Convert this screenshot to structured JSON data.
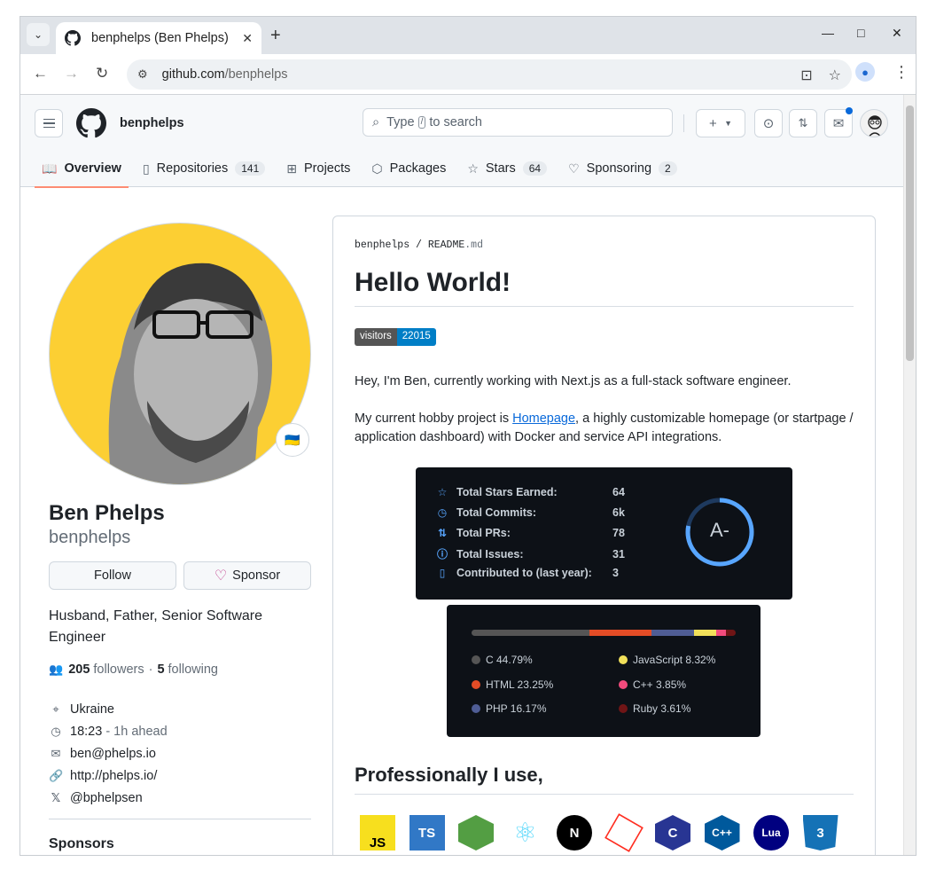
{
  "browser": {
    "tab_title": "benphelps (Ben Phelps)",
    "url_host": "github.com",
    "url_path": "/benphelps"
  },
  "header": {
    "username": "benphelps",
    "search_before": "Type",
    "search_key": "/",
    "search_after": "to search"
  },
  "nav": [
    {
      "label": "Overview",
      "count": null,
      "icon": "book-icon"
    },
    {
      "label": "Repositories",
      "count": "141",
      "icon": "repo-icon"
    },
    {
      "label": "Projects",
      "count": null,
      "icon": "table-icon"
    },
    {
      "label": "Packages",
      "count": null,
      "icon": "package-icon"
    },
    {
      "label": "Stars",
      "count": "64",
      "icon": "star-icon"
    },
    {
      "label": "Sponsoring",
      "count": "2",
      "icon": "heart-icon"
    }
  ],
  "profile": {
    "full_name": "Ben Phelps",
    "login": "benphelps",
    "follow_label": "Follow",
    "sponsor_label": "Sponsor",
    "bio": "Husband, Father, Senior Software Engineer",
    "followers": "205",
    "followers_label": "followers",
    "following": "5",
    "following_label": "following",
    "location": "Ukraine",
    "time": "18:23",
    "time_offset": "- 1h ahead",
    "email": "ben@phelps.io",
    "website": "http://phelps.io/",
    "twitter": "@bphelpsen",
    "sponsors_heading": "Sponsors",
    "status_emoji": "🇺🇦"
  },
  "readme": {
    "crumb_user": "benphelps",
    "crumb_sep": "/",
    "crumb_file": "README",
    "crumb_ext": ".md",
    "heading": "Hello World!",
    "badge_label": "visitors",
    "badge_value": "22015",
    "intro": "Hey, I'm Ben, currently working with Next.js as a full-stack software engineer.",
    "hobby_before": "My current hobby project is ",
    "hobby_link": "Homepage",
    "hobby_after": ", a highly customizable homepage (or startpage / application dashboard) with Docker and service API integrations.",
    "stats": [
      {
        "label": "Total Stars Earned:",
        "value": "64",
        "icon": "star-icon"
      },
      {
        "label": "Total Commits:",
        "value": "6k",
        "icon": "history-icon"
      },
      {
        "label": "Total PRs:",
        "value": "78",
        "icon": "pull-request-icon"
      },
      {
        "label": "Total Issues:",
        "value": "31",
        "icon": "issue-icon"
      },
      {
        "label": "Contributed to (last year):",
        "value": "3",
        "icon": "repo-icon"
      }
    ],
    "grade": "A-",
    "grade_fraction": 0.78,
    "languages": [
      {
        "name": "C",
        "pct": "44.79%",
        "share": 44.79,
        "color": "#555555"
      },
      {
        "name": "HTML",
        "pct": "23.25%",
        "share": 23.25,
        "color": "#e34c26"
      },
      {
        "name": "PHP",
        "pct": "16.17%",
        "share": 16.17,
        "color": "#4F5D95"
      },
      {
        "name": "JavaScript",
        "pct": "8.32%",
        "share": 8.32,
        "color": "#f1e05a"
      },
      {
        "name": "C++",
        "pct": "3.85%",
        "share": 3.85,
        "color": "#f34b7d"
      },
      {
        "name": "Ruby",
        "pct": "3.61%",
        "share": 3.61,
        "color": "#701516"
      }
    ],
    "subheading": "Professionally I use,",
    "tech_icons": [
      {
        "name": "javascript-icon",
        "text": "JS",
        "bg": "#f7df1e",
        "fg": "#000000"
      },
      {
        "name": "typescript-icon",
        "text": "TS",
        "bg": "#3178c6",
        "fg": "#ffffff"
      },
      {
        "name": "nodejs-icon",
        "text": "",
        "bg": "#539e43",
        "fg": "#ffffff"
      },
      {
        "name": "react-icon",
        "text": "⚛",
        "bg": "#ffffff",
        "fg": "#61dafb"
      },
      {
        "name": "nextjs-icon",
        "text": "N",
        "bg": "#000000",
        "fg": "#ffffff"
      },
      {
        "name": "laravel-icon",
        "text": "",
        "bg": "#ffffff",
        "fg": "#ff2d20"
      },
      {
        "name": "c-icon",
        "text": "C",
        "bg": "#283593",
        "fg": "#ffffff"
      },
      {
        "name": "cpp-icon",
        "text": "C++",
        "bg": "#00599c",
        "fg": "#ffffff"
      },
      {
        "name": "lua-icon",
        "text": "Lua",
        "bg": "#000080",
        "fg": "#ffffff"
      },
      {
        "name": "css3-icon",
        "text": "3",
        "bg": "#1572b6",
        "fg": "#ffffff"
      }
    ]
  }
}
